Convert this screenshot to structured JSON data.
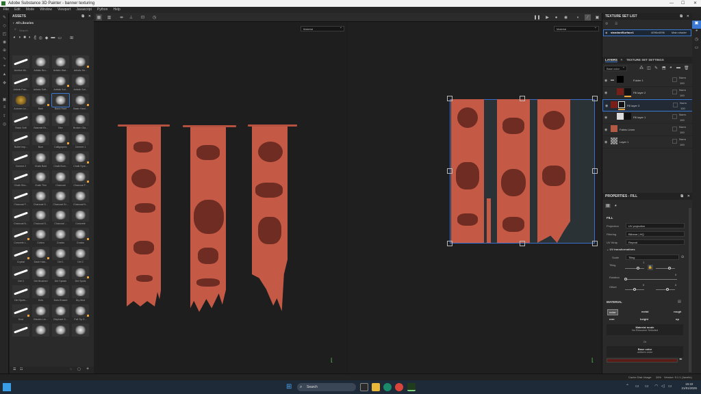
{
  "window": {
    "title": "Adobe Substance 3D Painter - banner texturing",
    "min": "—",
    "max": "☐",
    "close": "✕"
  },
  "menu": [
    "File",
    "Edit",
    "Mode",
    "Window",
    "Viewport",
    "Javascript",
    "Python",
    "Help"
  ],
  "assets": {
    "title": "ASSETS",
    "library": "All Libraries",
    "search_placeholder": "Search",
    "brushes": [
      "Archive Mi...",
      "Artistic Bru...",
      "Artistic Wat...",
      "Artistic He...",
      "Artistic Pain...",
      "Artistic Soft...",
      "Artistic Sof...",
      "Artistic Sof...",
      "Autumn Le...",
      "Bark",
      "Basic Hard",
      "Basic Hard...",
      "Basic Soft",
      "Basmati Br...",
      "Blur",
      "Broken Gla...",
      "Bullet Imp...",
      "Burn",
      "Calligraphic",
      "Cement 1",
      "Cement 2",
      "Chalk Bold",
      "Chalk Bum...",
      "Chalk Spre...",
      "Chalk Stro...",
      "Chalk Thin",
      "Charcoal",
      "Charcoal F...",
      "Charcoal F...",
      "Charcoal G...",
      "Charcoal Gr...",
      "Charcoal N...",
      "Charcoal N...",
      "Charcoal S...",
      "Charcoal ...",
      "Concrete",
      "Concrete L...",
      "Cotton",
      "Cracks",
      "Cracks",
      "Crystal",
      "Dash Halo...",
      "Dirt 1",
      "Dirt 2",
      "Dirt 3",
      "Dirt Brushed",
      "Dirt Splash",
      "Dirt Spots",
      "Dirt Spots...",
      "Dots",
      "Dots Erased",
      "Dry Mud",
      "Dust",
      "Electric Lin...",
      "Elephant S...",
      "Felt Tip E...",
      "",
      "",
      "",
      ""
    ]
  },
  "viewport": {
    "left_mode": "Material",
    "right_mode": "Material"
  },
  "texture_set_list": {
    "title": "TEXTURE SET LIST",
    "name": "standardSurface1",
    "resolution": "4096x4096",
    "shader": "Main shader"
  },
  "layers_panel": {
    "tab_layers": "LAYERS",
    "tab_settings": "TEXTURE SET SETTINGS",
    "channel": "Base color",
    "layers": [
      {
        "name": "Folder 1",
        "blend": "Norm",
        "opacity": "100"
      },
      {
        "name": "Fill layer 2",
        "blend": "Norm",
        "opacity": "100"
      },
      {
        "name": "Fill layer 3",
        "blend": "Norm",
        "opacity": "100"
      },
      {
        "name": "Fill layer 1",
        "blend": "Norm",
        "opacity": "100"
      },
      {
        "name": "Fabric Linen",
        "blend": "Norm",
        "opacity": "100"
      },
      {
        "name": "Layer 1",
        "blend": "Norm",
        "opacity": "100"
      }
    ]
  },
  "properties": {
    "title": "PROPERTIES - FILL",
    "section_fill": "FILL",
    "projection_label": "Projection",
    "projection": "UV projection",
    "filtering_label": "Filtering",
    "filtering": "Bilinear | HQ",
    "uvwrap_label": "UV Wrap",
    "uvwrap": "Repeat",
    "uvtrans": "UV transformations",
    "scale_label": "Scale",
    "scale": "Tiling",
    "tiling_label": "Tiling",
    "tiling_value": "1",
    "rotation_label": "Rotation",
    "rotation_value": "0",
    "offset_label": "Offset",
    "offset_value": "0",
    "section_material": "MATERIAL",
    "mat_btns": [
      "color",
      "metal",
      "rough",
      "nrm",
      "height",
      "op"
    ],
    "material_mode": "Material mode",
    "no_resource": "No Resource Selected",
    "or": "Or",
    "base_color": "Base color",
    "uniform_color": "uniform color",
    "swatch_color": "#5a1d15"
  },
  "status": {
    "cache": "Cache Disk Usage:",
    "cache_pct": "26%",
    "version": "Version: 9.1.1 (Javelin)"
  },
  "taskbar": {
    "search": "Search",
    "time": "15:22",
    "date": "21/01/2025"
  },
  "colors": {
    "banner": "#c45a46",
    "pattern": "#6e2c22",
    "accent": "#3a7ad5"
  }
}
